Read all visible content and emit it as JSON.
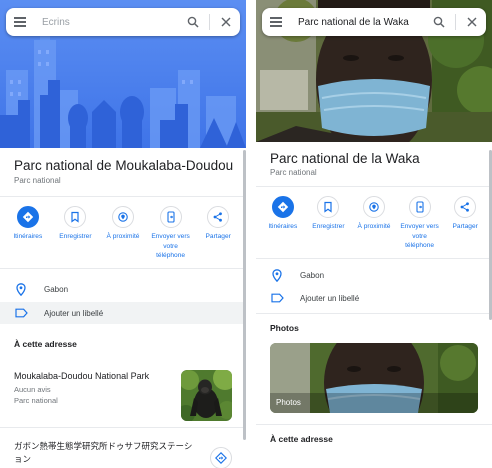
{
  "left": {
    "search": {
      "placeholder": "Ecrins"
    },
    "place": {
      "title": "Parc national de Moukalaba-Doudou",
      "subtitle": "Parc national"
    },
    "actions": [
      {
        "icon": "directions-icon",
        "label": "Itinéraires"
      },
      {
        "icon": "bookmark-icon",
        "label": "Enregistrer"
      },
      {
        "icon": "nearby-icon",
        "label": "À proximité"
      },
      {
        "icon": "send-to-phone-icon",
        "label": "Envoyer vers\nvotre\ntéléphone"
      },
      {
        "icon": "share-icon",
        "label": "Partager"
      }
    ],
    "info": [
      {
        "icon": "location-pin-icon",
        "text": "Gabon"
      },
      {
        "icon": "label-icon",
        "text": "Ajouter un libellé"
      }
    ],
    "section": "À cette adresse",
    "nearby": {
      "name": "Moukalaba-Doudou National Park",
      "reviews": "Aucun avis",
      "type": "Parc national"
    },
    "bottom_text": "ガボン熱帯生態学研究所ドゥサフ研究ステーション"
  },
  "right": {
    "search": {
      "query": "Parc national de la Waka"
    },
    "place": {
      "title": "Parc national de la Waka",
      "subtitle": "Parc national"
    },
    "actions": [
      {
        "icon": "directions-icon",
        "label": "Itinéraires"
      },
      {
        "icon": "bookmark-icon",
        "label": "Enregistrer"
      },
      {
        "icon": "nearby-icon",
        "label": "À proximité"
      },
      {
        "icon": "send-to-phone-icon",
        "label": "Envoyer vers\nvotre\ntéléphone"
      },
      {
        "icon": "share-icon",
        "label": "Partager"
      }
    ],
    "info": [
      {
        "icon": "location-pin-icon",
        "text": "Gabon"
      },
      {
        "icon": "label-icon",
        "text": "Ajouter un libellé"
      }
    ],
    "photos_section": "Photos",
    "photo_label": "Photos",
    "section": "À cette adresse"
  },
  "colors": {
    "accent": "#1a73e8",
    "hero_blue": "#4d7ff0",
    "text": "#202124",
    "muted": "#70757a"
  }
}
